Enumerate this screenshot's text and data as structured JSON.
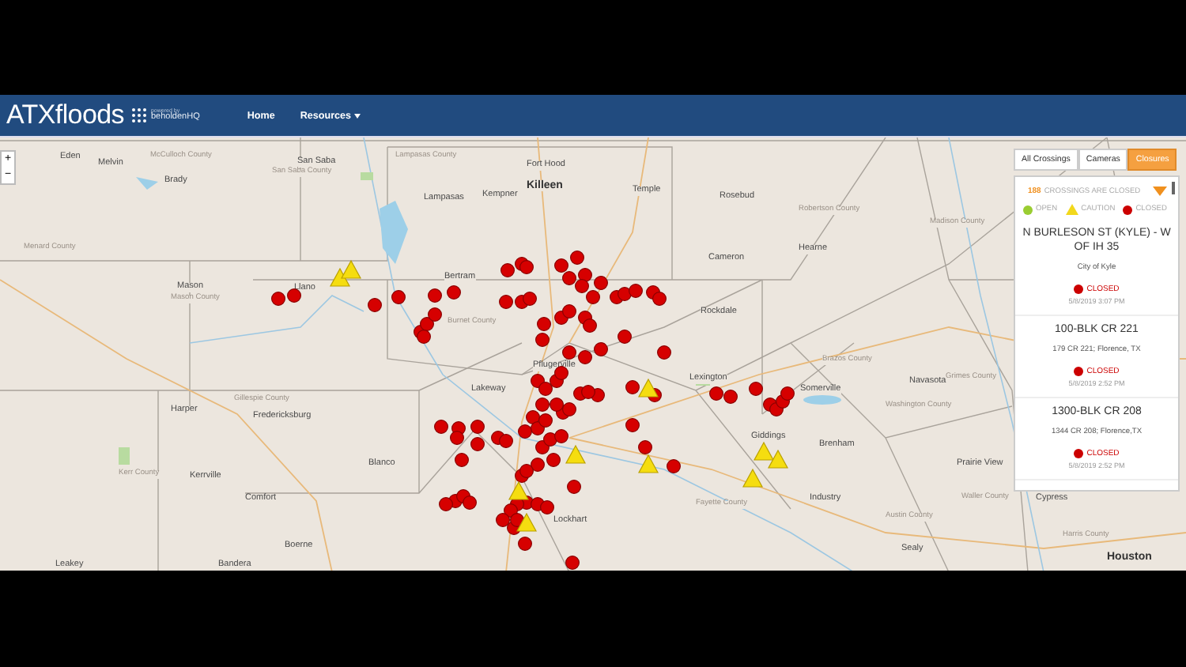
{
  "navbar": {
    "brand": "ATXfloods",
    "powered_by": "powered by",
    "partner": "beholdenHQ",
    "links": [
      {
        "label": "Home",
        "dropdown": false
      },
      {
        "label": "Resources",
        "dropdown": true
      }
    ]
  },
  "zoom_controls": [
    "+",
    "−"
  ],
  "map_labels": [
    {
      "text": "Eden",
      "kind": "town"
    },
    {
      "text": "Melvin",
      "kind": "town"
    },
    {
      "text": "McCulloch County",
      "kind": "county"
    },
    {
      "text": "Brady",
      "kind": "town"
    },
    {
      "text": "San Saba",
      "kind": "town"
    },
    {
      "text": "San Saba County",
      "kind": "county"
    },
    {
      "text": "Lampasas County",
      "kind": "county"
    },
    {
      "text": "Fort Hood",
      "kind": "town"
    },
    {
      "text": "Lampasas",
      "kind": "town"
    },
    {
      "text": "Kempner",
      "kind": "town"
    },
    {
      "text": "Killeen",
      "kind": "city"
    },
    {
      "text": "Temple",
      "kind": "town"
    },
    {
      "text": "Rosebud",
      "kind": "town"
    },
    {
      "text": "Robertson County",
      "kind": "county"
    },
    {
      "text": "Madison County",
      "kind": "county"
    },
    {
      "text": "Cameron",
      "kind": "town"
    },
    {
      "text": "Hearne",
      "kind": "town"
    },
    {
      "text": "Menard County",
      "kind": "county"
    },
    {
      "text": "Mason",
      "kind": "town"
    },
    {
      "text": "Mason County",
      "kind": "county"
    },
    {
      "text": "Llano",
      "kind": "town"
    },
    {
      "text": "Bertram",
      "kind": "town"
    },
    {
      "text": "Burnet County",
      "kind": "county"
    },
    {
      "text": "Rockdale",
      "kind": "town"
    },
    {
      "text": "Brazos County",
      "kind": "county"
    },
    {
      "text": "Grimes County",
      "kind": "county"
    },
    {
      "text": "Pflugerville",
      "kind": "town"
    },
    {
      "text": "Lexington",
      "kind": "town"
    },
    {
      "text": "Navasota",
      "kind": "town"
    },
    {
      "text": "Lakeway",
      "kind": "town"
    },
    {
      "text": "Somerville",
      "kind": "town"
    },
    {
      "text": "Harper",
      "kind": "town"
    },
    {
      "text": "Gillespie County",
      "kind": "county"
    },
    {
      "text": "Fredericksburg",
      "kind": "town"
    },
    {
      "text": "Giddings",
      "kind": "town"
    },
    {
      "text": "Washington County",
      "kind": "county"
    },
    {
      "text": "Brenham",
      "kind": "town"
    },
    {
      "text": "Prairie View",
      "kind": "town"
    },
    {
      "text": "Blanco",
      "kind": "town"
    },
    {
      "text": "Kerr County",
      "kind": "county"
    },
    {
      "text": "Kerrville",
      "kind": "town"
    },
    {
      "text": "Comfort",
      "kind": "town"
    },
    {
      "text": "Industry",
      "kind": "town"
    },
    {
      "text": "Lockhart",
      "kind": "town"
    },
    {
      "text": "Fayette County",
      "kind": "county"
    },
    {
      "text": "Austin County",
      "kind": "county"
    },
    {
      "text": "Waller County",
      "kind": "county"
    },
    {
      "text": "Boerne",
      "kind": "town"
    },
    {
      "text": "Leakey",
      "kind": "town"
    },
    {
      "text": "Bandera",
      "kind": "town"
    },
    {
      "text": "Sealy",
      "kind": "town"
    },
    {
      "text": "Cypress",
      "kind": "town"
    },
    {
      "text": "Harris County",
      "kind": "county"
    },
    {
      "text": "Houston",
      "kind": "city"
    }
  ],
  "panel": {
    "tabs": [
      {
        "label": "All Crossings",
        "selected": false
      },
      {
        "label": "Cameras",
        "selected": false
      },
      {
        "label": "Closures",
        "selected": true
      }
    ],
    "count": "188",
    "count_label": "CROSSINGS ARE CLOSED",
    "legend": [
      {
        "label": "OPEN",
        "kind": "dot",
        "color": "#9acd32"
      },
      {
        "label": "CAUTION",
        "kind": "triangle",
        "color": "#f2d81c"
      },
      {
        "label": "CLOSED",
        "kind": "dot",
        "color": "#cc0000"
      }
    ],
    "closures": [
      {
        "title": "N BURLESON ST (KYLE) - W OF IH 35",
        "location": "City of Kyle",
        "status": "CLOSED",
        "kind": "closed",
        "date": "5/8/2019 3:07 PM"
      },
      {
        "title": "100-BLK CR 221",
        "location": "179 CR 221; Florence, TX",
        "status": "CLOSED",
        "kind": "closed",
        "date": "5/8/2019 2:52 PM"
      },
      {
        "title": "1300-BLK CR 208",
        "location": "1344 CR 208; Florence,TX",
        "status": "CLOSED",
        "kind": "closed",
        "date": "5/8/2019 2:52 PM"
      }
    ]
  }
}
